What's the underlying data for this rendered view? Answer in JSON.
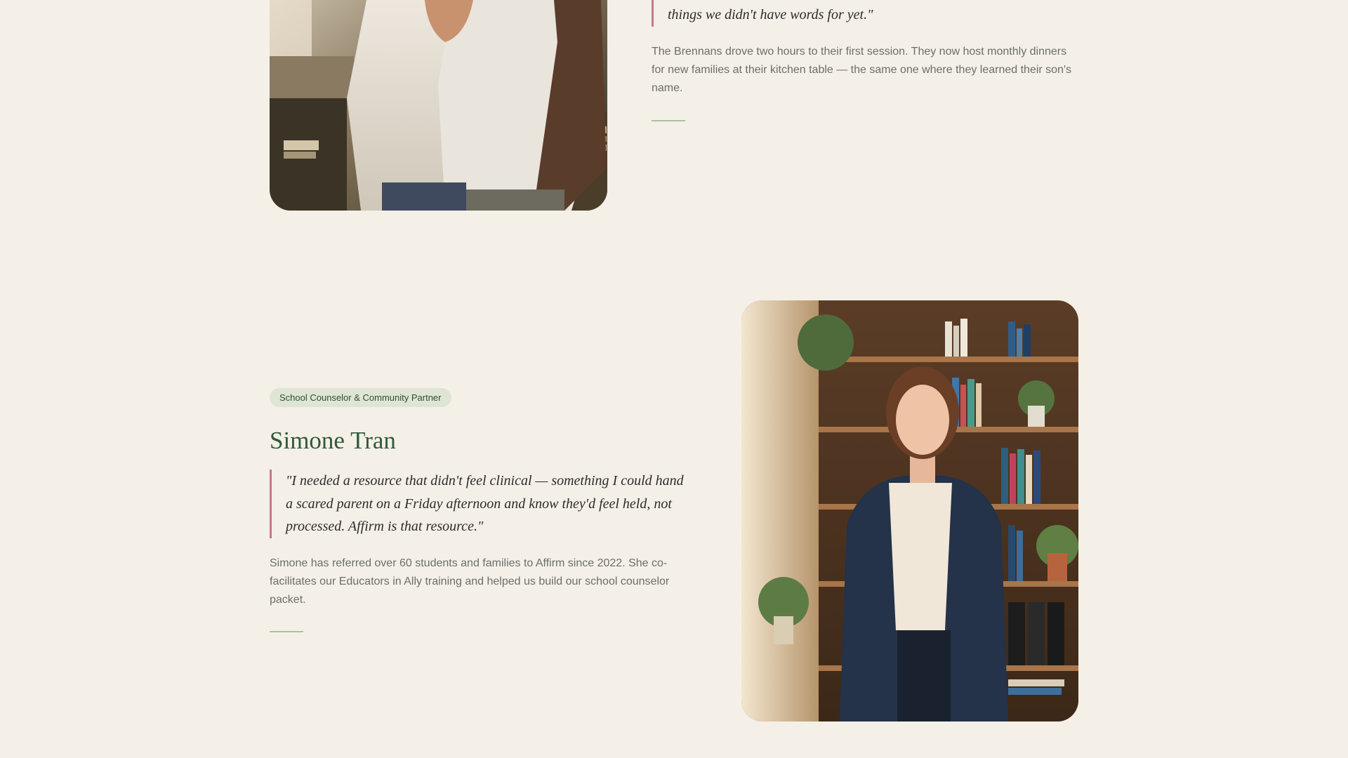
{
  "story_brennan": {
    "quote": "things we didn't have words for yet.\"",
    "body": "The Brennans drove two hours to their first session. They now host monthly dinners for new families at their kitchen table — the same one where they learned their son's name."
  },
  "story_simone": {
    "badge": "School Counselor & Community Partner",
    "name": "Simone Tran",
    "quote": "\"I needed a resource that didn't feel clinical — something I could hand a scared parent on a Friday afternoon and know they'd feel held, not processed. Affirm is that resource.\"",
    "body": "Simone has referred over 60 students and families to Affirm since 2022. She co-facilitates our Educators in Ally training and helped us build our school counselor packet."
  },
  "colors": {
    "background": "#f5f0e7",
    "accent_green": "#2f5a3a",
    "quote_border": "#c07a8e",
    "badge_bg": "#dfe5d4",
    "rule": "#a8c2a0"
  }
}
